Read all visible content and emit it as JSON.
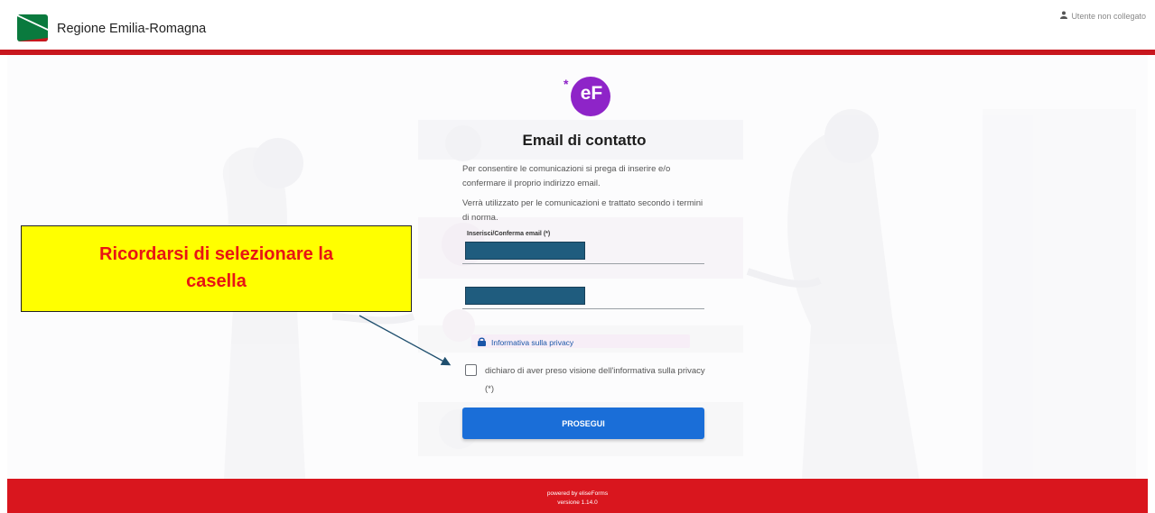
{
  "header": {
    "title": "Regione Emilia-Romagna",
    "user_status": "Utente non collegato"
  },
  "brand": {
    "logo_text": "eF"
  },
  "form": {
    "title": "Email di contatto",
    "intro_1": "Per consentire le comunicazioni si prega di inserire e/o confermare il proprio indirizzo email.",
    "intro_2": "Verrà utilizzato per le comunicazioni e trattato secondo i termini di norma.",
    "email_label": "Inserisci/Conferma email (*)",
    "privacy_link": "Informativa sulla privacy",
    "checkbox_label": "dichiaro di aver preso visione dell'informativa sulla privacy (*)",
    "submit_label": "PROSEGUI"
  },
  "annotation": {
    "text_1": "Ricordarsi di selezionare la",
    "text_2": "casella"
  },
  "footer": {
    "powered": "powered by eliseForms",
    "version": "versione 1.14.0"
  },
  "colors": {
    "accent_red": "#c8171e",
    "footer_red": "#d9161e",
    "button_blue": "#1a6ed8",
    "brand_purple": "#8e24c8",
    "callout_yellow": "#ffff00",
    "callout_text": "#e81414"
  }
}
